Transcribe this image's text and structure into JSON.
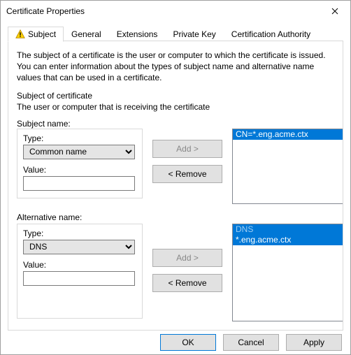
{
  "window": {
    "title": "Certificate Properties"
  },
  "tabs": {
    "subject": "Subject",
    "general": "General",
    "extensions": "Extensions",
    "private_key": "Private Key",
    "cert_authority": "Certification Authority"
  },
  "description": "The subject of a certificate is the user or computer to which the certificate is issued. You can enter information about the types of subject name and alternative name values that can be used in a certificate.",
  "section": {
    "title": "Subject of certificate",
    "sub": "The user or computer that is receiving the certificate"
  },
  "subject_name": {
    "heading": "Subject name:",
    "type_label": "Type:",
    "type_value": "Common name",
    "value_label": "Value:",
    "value_text": "",
    "add": "Add >",
    "remove": "< Remove",
    "list": [
      "CN=*.eng.acme.ctx"
    ]
  },
  "alt_name": {
    "heading": "Alternative name:",
    "type_label": "Type:",
    "type_value": "DNS",
    "value_label": "Value:",
    "value_text": "",
    "add": "Add >",
    "remove": "< Remove",
    "list_head": "DNS",
    "list": [
      "*.eng.acme.ctx"
    ]
  },
  "footer": {
    "ok": "OK",
    "cancel": "Cancel",
    "apply": "Apply"
  }
}
